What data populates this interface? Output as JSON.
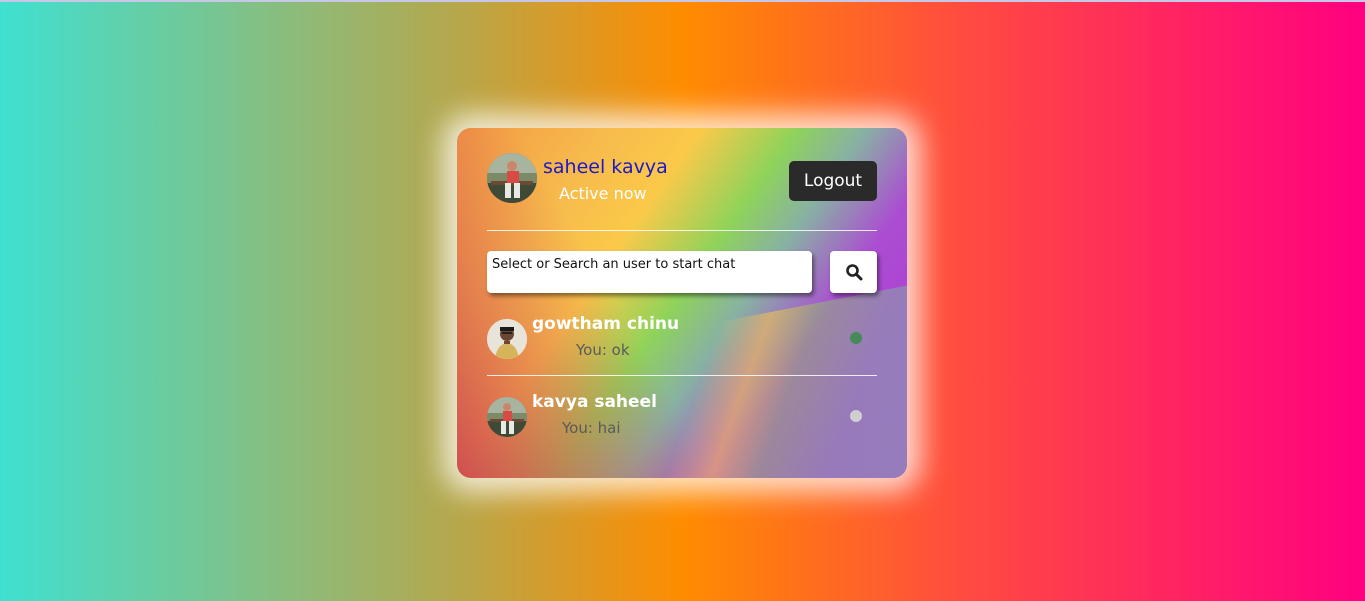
{
  "current_user": {
    "name": "saheel kavya",
    "status": "Active now"
  },
  "header": {
    "logout_label": "Logout"
  },
  "search": {
    "placeholder": "Select or Search an user to start chat"
  },
  "users": [
    {
      "name": "gowtham chinu",
      "last_message": "You: ok",
      "online": true,
      "status_color": "#468a5a"
    },
    {
      "name": "kavya saheel",
      "last_message": "You: hai",
      "online": false,
      "status_color": "#cfcfcf"
    }
  ],
  "icons": {
    "search": "search-icon"
  }
}
